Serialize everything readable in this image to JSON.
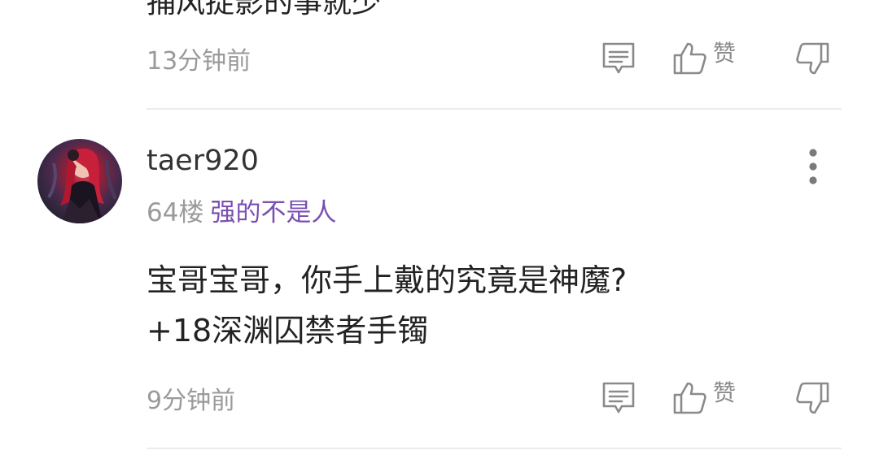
{
  "previous_comment": {
    "clipped_text": "捕风捉影的事就少",
    "time": "13分钟前"
  },
  "actions": {
    "like_label": "赞"
  },
  "comment": {
    "username": "taer920",
    "floor": "64楼",
    "tag": "强的不是人",
    "lines": [
      "宝哥宝哥，你手上戴的究竟是神魔?",
      "+18深渊囚禁者手镯"
    ],
    "time": "9分钟前"
  },
  "colors": {
    "tag_purple": "#7a4fb0",
    "meta_gray": "#9a9a9a",
    "text_dark": "#222222"
  }
}
